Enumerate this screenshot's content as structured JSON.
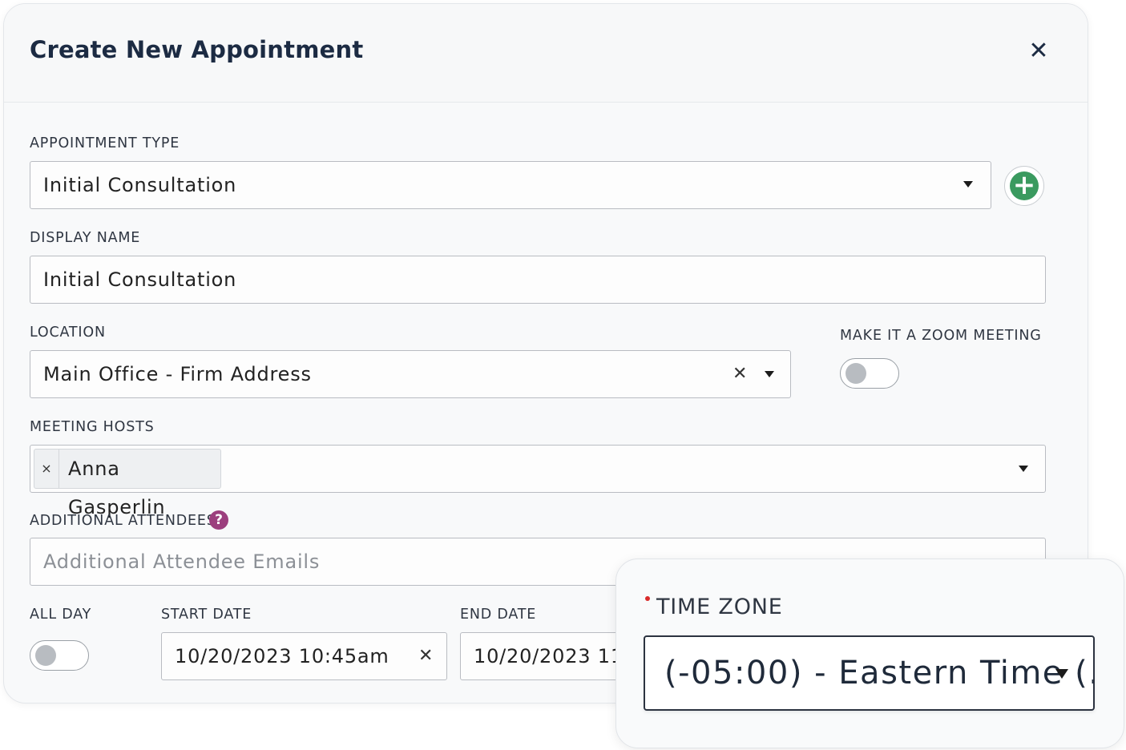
{
  "modal": {
    "title": "Create New Appointment",
    "close_symbol": "✕"
  },
  "appointment_type": {
    "label": "APPOINTMENT TYPE",
    "value": "Initial Consultation",
    "add_symbol": "+"
  },
  "display_name": {
    "label": "DISPLAY NAME",
    "value": "Initial Consultation"
  },
  "location": {
    "label": "LOCATION",
    "value": "Main Office - Firm Address",
    "clear_symbol": "✕"
  },
  "zoom": {
    "label": "MAKE IT A ZOOM MEETING",
    "enabled": false
  },
  "meeting_hosts": {
    "label": "MEETING HOSTS",
    "chips": [
      {
        "label": "Anna Gasperlin",
        "remove_symbol": "×"
      }
    ]
  },
  "additional_attendees": {
    "label": "ADDITIONAL ATTENDEES",
    "help_symbol": "?",
    "placeholder": "Additional Attendee Emails",
    "value": ""
  },
  "all_day": {
    "label": "ALL DAY",
    "enabled": false
  },
  "start_date": {
    "label": "START DATE",
    "value": "10/20/2023 10:45am",
    "clear_symbol": "✕"
  },
  "end_date": {
    "label": "END DATE",
    "value": "10/20/2023 11"
  },
  "time_zone": {
    "label": "TIME ZONE",
    "required": true,
    "value": "(-05:00) - Eastern Time (..."
  },
  "colors": {
    "add_button": "#3a9a5f",
    "help_icon": "#9c3f7e",
    "required_dot": "#d92a2a",
    "title_text": "#1c2b43"
  }
}
